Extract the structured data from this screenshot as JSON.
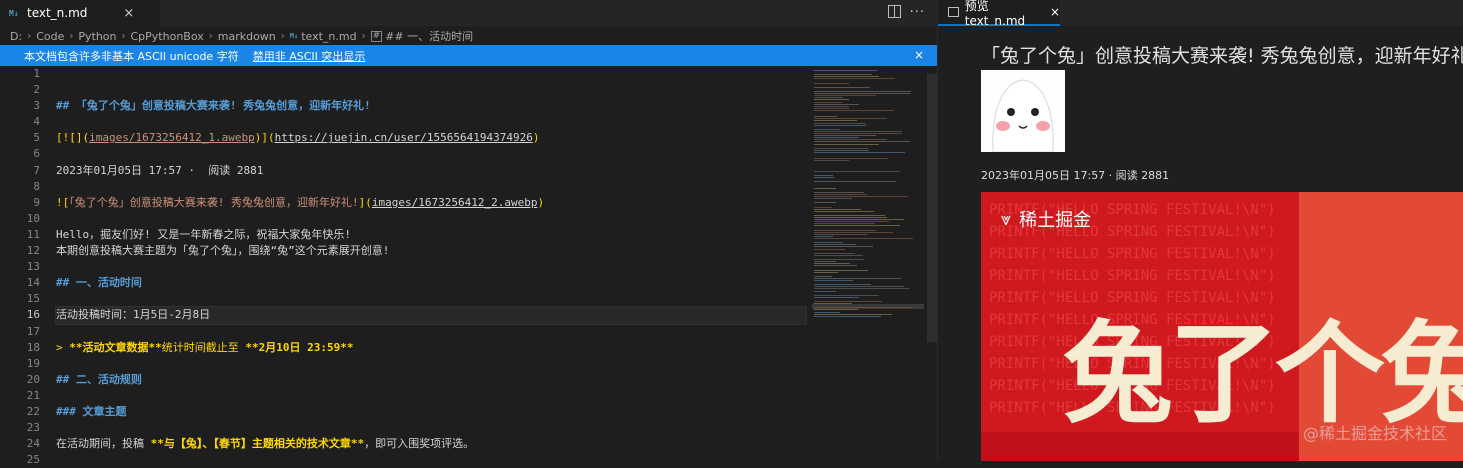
{
  "editor": {
    "tab": {
      "icon": "M↓",
      "label": "text_n.md",
      "close": "×"
    },
    "more_actions": "···",
    "breadcrumbs": [
      "D:",
      "Code",
      "Python",
      "CpPythonBox",
      "markdown",
      "text_n.md",
      "## 一、活动时间"
    ],
    "breadcrumb_file_icon": "M↓",
    "notification": {
      "message": "本文档包含许多非基本 ASCII unicode 字符",
      "action": "禁用非 ASCII 突出显示",
      "close": "×"
    },
    "line_numbers": [
      "1",
      "2",
      "3",
      "4",
      "5",
      "6",
      "7",
      "8",
      "9",
      "10",
      "11",
      "12",
      "13",
      "14",
      "15",
      "16",
      "17",
      "18",
      "19",
      "20",
      "21",
      "22",
      "23",
      "24",
      "25"
    ],
    "active_line": 16,
    "lines": {
      "l3_hash": "## ",
      "l3_text": "「兔了个兔」创意投稿大赛来袭! 秀兔兔创意，迎新年好礼!",
      "l5_open": "[![](",
      "l5_img": "images/1673256412_1.awebp",
      "l5_mid": ")](",
      "l5_url": "https://juejin.cn/user/1556564194374926",
      "l5_close": ")",
      "l7": "2023年01月05日 17:57 ·  阅读 2881",
      "l9_open": "![",
      "l9_alt": "「兔了个兔」创意投稿大赛来袭! 秀兔兔创意，迎新年好礼!",
      "l9_mid": "](",
      "l9_path": "images/1673256412_2.awebp",
      "l9_close": ")",
      "l11": "Hello，掘友们好! 又是一年新春之际，祝福大家兔年快乐!",
      "l12": "本期创意投稿大赛主题为「兔了个兔」，围绕“兔”这个元素展开创意!",
      "l14": "## 一、活动时间",
      "l16": "活动投稿时间：1月5日-2月8日",
      "l18_quote": "> ",
      "l18_b1": "**活动文章数据**",
      "l18_mid": "统计时间截止至 ",
      "l18_b2": "**2月10日 23:59**",
      "l20": "## 二、活动规则",
      "l22": "### 文章主题",
      "l24_pre": "在活动期间，投稿 ",
      "l24_bold": "**与【兔】、【春节】主题相关的技术文章**",
      "l24_post": "，即可入围奖项评选。"
    }
  },
  "preview": {
    "tab": {
      "label": "预览 text_n.md",
      "close": "×"
    },
    "title": "「兔了个兔」创意投稿大赛来袭! 秀兔兔创意，迎新年好礼!",
    "meta": "2023年01月05日 17:57 · 阅读 2881",
    "image": {
      "logo": "稀土掘金",
      "code_text": "PRINTF(\"HELLO SPRING FESTIVAL!\\N\")",
      "big_text": "兔了个兔",
      "watermark": "@稀土掘金技术社区"
    }
  }
}
